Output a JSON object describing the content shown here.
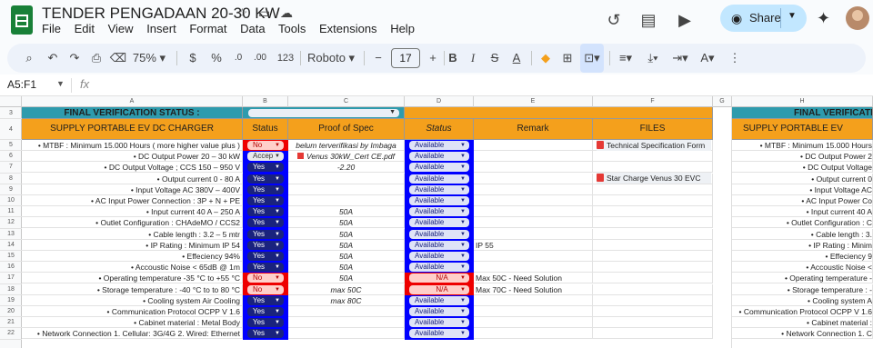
{
  "app": {
    "title": "TENDER PENGADAAN 20-30 KW",
    "menu": [
      "File",
      "Edit",
      "View",
      "Insert",
      "Format",
      "Data",
      "Tools",
      "Extensions",
      "Help"
    ],
    "share_label": "Share"
  },
  "toolbar": {
    "zoom": "75%",
    "currency": "$",
    "percent": "%",
    "decimals": ".0",
    "decimals_more": ".00",
    "number_format": "123",
    "font": "Roboto",
    "font_size": "17",
    "minus": "−",
    "plus": "+",
    "bold": "B",
    "italic": "I",
    "strike": "S",
    "text_color": "A"
  },
  "formula_bar": {
    "namebox": "A5:F1",
    "fx": "fx"
  },
  "columns": [
    "A",
    "B",
    "C",
    "D",
    "E",
    "F",
    "G",
    "H"
  ],
  "rows": [
    "3",
    "4",
    "5",
    "6",
    "7",
    "8",
    "9",
    "10",
    "11",
    "12",
    "13",
    "14",
    "15",
    "16",
    "17",
    "18",
    "19",
    "20",
    "21",
    "22"
  ],
  "sheet": {
    "final_status_label": "FINAL VERIFICATION STATUS :",
    "supply_label": "SUPPLY PORTABLE EV DC CHARGER",
    "h_status": "Status",
    "h_proof": "Proof of Spec",
    "h_status2": "Status",
    "h_remark": "Remark",
    "h_files": "FILES",
    "right_final_label": "FINAL VERIFICATI",
    "right_supply_label": "SUPPLY PORTABLE EV",
    "items": [
      "• MTBF : Minimum 15.000 Hours ( more higher value plus )",
      "• DC Output Power 20 – 30 kW",
      "• DC Output Voltage ; CCS 150 – 950 V",
      "• Output current 0 - 80 A",
      "• Input Voltage AC 380V – 400V",
      "• AC Input Power Connection : 3P + N + PE",
      "• Input current 40 A – 250 A",
      "• Outlet Configuration : CHAdeMO / CCS2",
      "• Cable length : 3.2 – 5 mtr",
      "• IP Rating : Minimum IP 54",
      "• Effeciency 94%",
      "• Accoustic Noise < 65dB @ 1m",
      "• Operating temperature -35 °C to +55 °C",
      "• Storage temperature : -40 °C to to 80 °C",
      "• Cooling system Air Cooling",
      "• Communication Protocol OCPP V 1.6",
      "• Cabinet material : Metal Body",
      "• Network Connection 1. Cellular: 3G/4G 2. Wired: Ethernet"
    ],
    "status": [
      "No",
      "Accep",
      "Yes",
      "Yes",
      "Yes",
      "Yes",
      "Yes",
      "Yes",
      "Yes",
      "Yes",
      "Yes",
      "Yes",
      "No",
      "No",
      "Yes",
      "Yes",
      "Yes",
      "Yes"
    ],
    "proof": [
      "belum terverifikasi by Imbaga",
      "Venus 30kW_Cert CE.pdf",
      "-2.20",
      "",
      "",
      "",
      "50A",
      "50A",
      "50A",
      "50A",
      "50A",
      "50A",
      "50A",
      "max 50C",
      "max 80C",
      "",
      "",
      ""
    ],
    "status2": [
      "Available",
      "Available",
      "Available",
      "Available",
      "Available",
      "Available",
      "Available",
      "Available",
      "Available",
      "Available",
      "Available",
      "Available",
      "N/A",
      "N/A",
      "Available",
      "Available",
      "Available",
      "Available"
    ],
    "remark": [
      "",
      "",
      "",
      "",
      "",
      "",
      "",
      "",
      "",
      "IP 55",
      "",
      "",
      "Max 50C - Need Solution",
      "Max 70C - Need Solution",
      "",
      "",
      "",
      ""
    ],
    "files": [
      "Technical Specification Form",
      "",
      "Star Charge Venus 30 EVC"
    ],
    "right_items": [
      "• MTBF : Minimum 15.000 Hours",
      "• DC Output Power 2",
      "• DC Output Voltage",
      "• Output current 0",
      "• Input Voltage AC",
      "• AC Input Power Co",
      "• Input current 40 A",
      "• Outlet Configuration : C",
      "• Cable length : 3.",
      "• IP Rating : Minim",
      "• Effeciency 9",
      "• Accoustic Noise <",
      "• Operating temperature -",
      "• Storage temperature : -",
      "• Cooling system A",
      "• Communication Protocol OCPP V 1.6",
      "• Cabinet material :",
      "• Network Connection 1. C"
    ]
  },
  "colors": {
    "teal": "#2e9bad",
    "orange": "#f4a01c",
    "blue": "#0000ff",
    "navy": "#1a237e"
  }
}
